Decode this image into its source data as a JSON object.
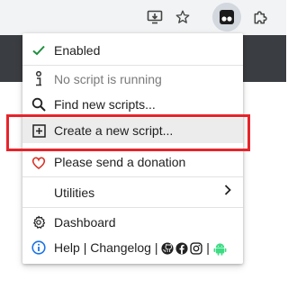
{
  "menu": {
    "enabled": "Enabled",
    "no_script": "No script is running",
    "find_scripts": "Find new scripts...",
    "create_script": "Create a new script...",
    "donation": "Please send a donation",
    "utilities": "Utilities",
    "dashboard": "Dashboard",
    "help": "Help",
    "changelog": "Changelog",
    "pipe": "|"
  },
  "colors": {
    "check": "#1e8e3e",
    "heart": "#d93025",
    "info": "#1a73e8",
    "android": "#3ddc84",
    "highlight": "#e8232a"
  },
  "icons": [
    "install-app-icon",
    "star-icon",
    "tampermonkey-icon",
    "puzzle-icon",
    "check-icon",
    "info-stick-icon",
    "search-icon",
    "plus-box-icon",
    "heart-icon",
    "gear-icon",
    "info-circle-icon",
    "github-icon",
    "facebook-icon",
    "instagram-icon",
    "android-icon",
    "chevron-right-icon"
  ]
}
